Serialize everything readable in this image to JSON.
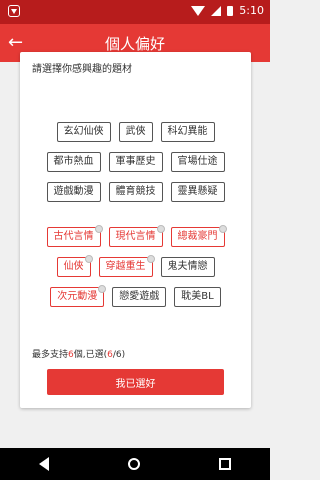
{
  "statusbar": {
    "time": "5:10"
  },
  "appbar": {
    "back_glyph": "←",
    "title": "個人偏好"
  },
  "card": {
    "prompt": "請選擇你感興趣的題材",
    "group1": [
      [
        "玄幻仙俠",
        "武俠",
        "科幻異能"
      ],
      [
        "都市熱血",
        "軍事歷史",
        "官場仕途"
      ],
      [
        "遊戲動漫",
        "體育競技",
        "靈異懸疑"
      ]
    ],
    "group2": [
      [
        {
          "label": "古代言情",
          "selected": true
        },
        {
          "label": "現代言情",
          "selected": true
        },
        {
          "label": "總裁豪門",
          "selected": true
        }
      ],
      [
        {
          "label": "仙俠",
          "selected": true
        },
        {
          "label": "穿越重生",
          "selected": true
        },
        {
          "label": "鬼夫情戀",
          "selected": false
        }
      ],
      [
        {
          "label": "次元動漫",
          "selected": true
        },
        {
          "label": "戀愛遊戲",
          "selected": false
        },
        {
          "label": "耽美BL",
          "selected": false
        }
      ]
    ],
    "limit_prefix": "最多支持",
    "limit_max": "6",
    "limit_mid": "個,已選(",
    "limit_selected": "6",
    "limit_sep": "/",
    "limit_total": "6",
    "limit_suffix": ")",
    "confirm_label": "我已選好"
  },
  "colors": {
    "accent": "#e53935",
    "statusbar": "#b71c1c"
  }
}
